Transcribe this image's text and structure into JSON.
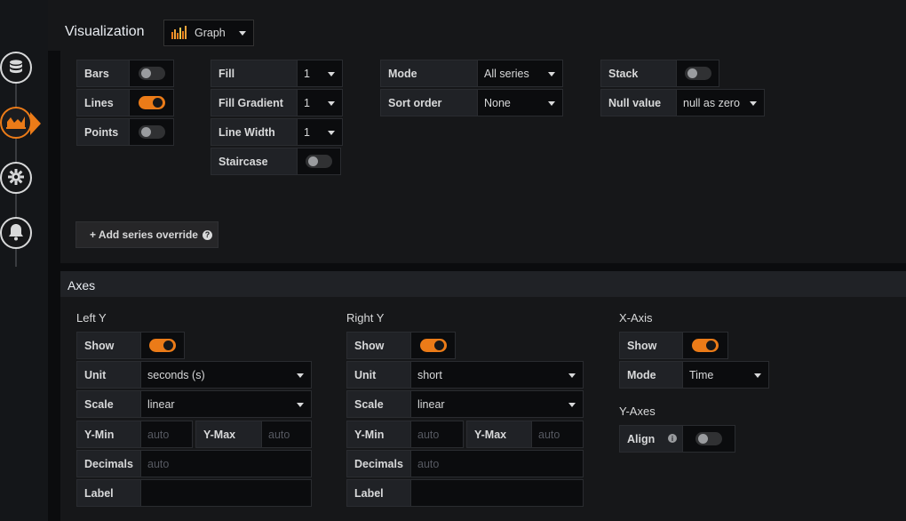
{
  "header": {
    "title": "Visualization",
    "viz_picker": {
      "label": "Graph",
      "icon": "graph-bars-icon"
    }
  },
  "rail": {
    "items": [
      {
        "name": "queries",
        "icon": "database-icon"
      },
      {
        "name": "visualization",
        "icon": "graph-icon",
        "active": true
      },
      {
        "name": "general",
        "icon": "gear-icon"
      },
      {
        "name": "alert",
        "icon": "bell-icon"
      }
    ]
  },
  "draw": {
    "bars_label": "Bars",
    "bars_on": false,
    "lines_label": "Lines",
    "lines_on": true,
    "points_label": "Points",
    "points_on": false
  },
  "mode_opts": {
    "fill_label": "Fill",
    "fill_value": "1",
    "fill_gradient_label": "Fill Gradient",
    "fill_gradient_value": "1",
    "line_width_label": "Line Width",
    "line_width_value": "1",
    "staircase_label": "Staircase",
    "staircase_on": false
  },
  "hover": {
    "mode_label": "Mode",
    "mode_value": "All series",
    "sort_label": "Sort order",
    "sort_value": "None"
  },
  "stacking": {
    "stack_label": "Stack",
    "stack_on": false,
    "null_label": "Null value",
    "null_value": "null as zero"
  },
  "add_override_label": "+ Add series override",
  "axes": {
    "title": "Axes",
    "left_y": {
      "title": "Left Y",
      "show_label": "Show",
      "show_on": true,
      "unit_label": "Unit",
      "unit_value": "seconds (s)",
      "scale_label": "Scale",
      "scale_value": "linear",
      "ymin_label": "Y-Min",
      "ymin_placeholder": "auto",
      "ymax_label": "Y-Max",
      "ymax_placeholder": "auto",
      "decimals_label": "Decimals",
      "decimals_placeholder": "auto",
      "label_label": "Label"
    },
    "right_y": {
      "title": "Right Y",
      "show_label": "Show",
      "show_on": true,
      "unit_label": "Unit",
      "unit_value": "short",
      "scale_label": "Scale",
      "scale_value": "linear",
      "ymin_label": "Y-Min",
      "ymin_placeholder": "auto",
      "ymax_label": "Y-Max",
      "ymax_placeholder": "auto",
      "decimals_label": "Decimals",
      "decimals_placeholder": "auto",
      "label_label": "Label"
    },
    "x_axis": {
      "title": "X-Axis",
      "show_label": "Show",
      "show_on": true,
      "mode_label": "Mode",
      "mode_value": "Time"
    },
    "y_axes": {
      "title": "Y-Axes",
      "align_label": "Align",
      "align_on": false
    }
  },
  "colors": {
    "accent": "#eb7b18",
    "panel": "#161719",
    "input": "#0b0c0e"
  }
}
